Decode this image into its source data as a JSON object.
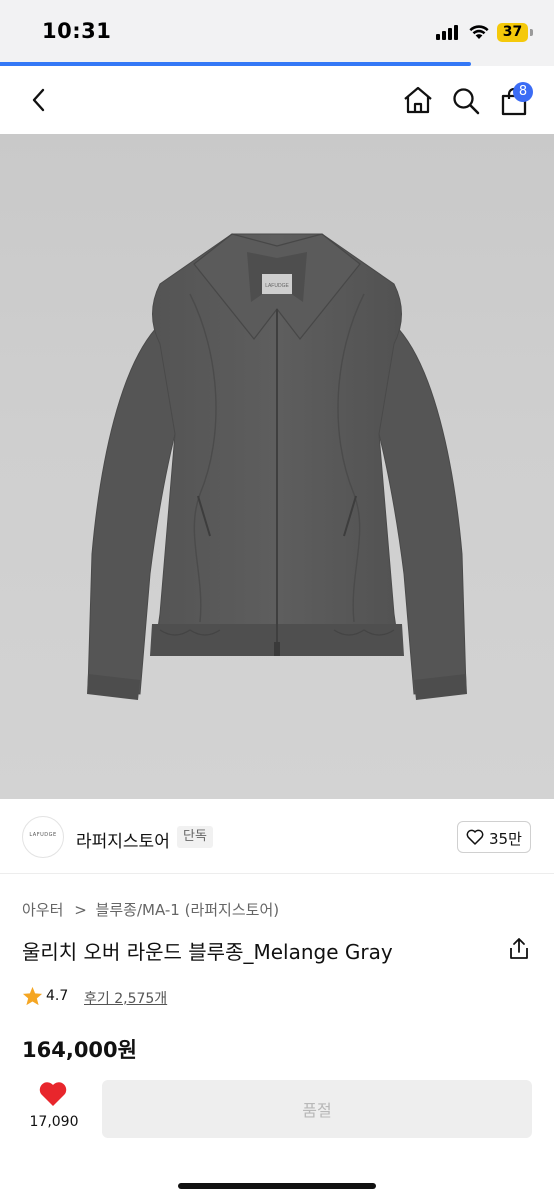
{
  "status_bar": {
    "time": "10:31",
    "battery_level": "37",
    "signal_icon": "cellular-signal-icon",
    "wifi_icon": "wifi-icon",
    "battery_color": "#f5c90a"
  },
  "page_load_progress": 0.85,
  "nav": {
    "back_icon": "chevron-left-icon",
    "home_icon": "home-icon",
    "search_icon": "search-icon",
    "cart_icon": "shopping-bag-icon",
    "cart_badge": "8",
    "accent_color": "#3b6cf5"
  },
  "product_image": {
    "subject": "gray wool bomber jacket",
    "label_text": "LAFUDGE"
  },
  "store": {
    "logo_text": "LAFUDGE",
    "name": "라퍼지스토어",
    "tag": "단독",
    "like_icon": "heart-outline-icon",
    "like_count": "35만"
  },
  "breadcrumb": {
    "category": "아우터",
    "separator": ">",
    "subcategory": "블루종/MA-1 (라퍼지스토어)"
  },
  "product": {
    "title": "울리치 오버 라운드 블루종_Melange Gray",
    "share_icon": "share-icon",
    "rating_icon": "star-icon",
    "rating": "4.7",
    "reviews": "후기 2,575개",
    "price": "164,000원"
  },
  "bottom_bar": {
    "wish_icon": "heart-filled-icon",
    "wish_count": "17,090",
    "wish_color": "#e8262c",
    "buy_button_label": "품절"
  }
}
